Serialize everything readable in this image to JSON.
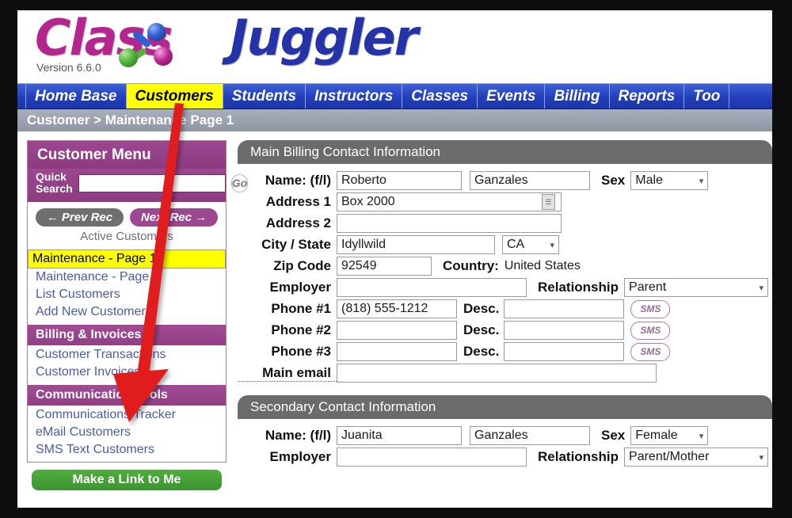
{
  "brand": {
    "name_part1": "Class",
    "name_part2": "Juggler",
    "version": "Version 6.6.0"
  },
  "nav": {
    "items": [
      {
        "label": "Home Base",
        "active": false
      },
      {
        "label": "Customers",
        "active": true
      },
      {
        "label": "Students",
        "active": false
      },
      {
        "label": "Instructors",
        "active": false
      },
      {
        "label": "Classes",
        "active": false
      },
      {
        "label": "Events",
        "active": false
      },
      {
        "label": "Billing",
        "active": false
      },
      {
        "label": "Reports",
        "active": false
      },
      {
        "label": "Too",
        "active": false
      }
    ]
  },
  "breadcrumb": "Customer > Maintenance Page 1",
  "sidebar": {
    "title": "Customer Menu",
    "quick_search": {
      "label_line1": "Quick",
      "label_line2": "Search",
      "value": "",
      "placeholder": "",
      "go_label": "Go"
    },
    "prev_label": "Prev Rec",
    "next_label": "Next Rec",
    "record_scope": "Active Customers",
    "main_links": [
      {
        "label": "Maintenance - Page 1",
        "selected": true
      },
      {
        "label": "Maintenance - Page 2",
        "selected": false
      },
      {
        "label": "List Customers",
        "selected": false
      },
      {
        "label": "Add New Customer",
        "selected": false
      }
    ],
    "groups": [
      {
        "title": "Billing & Invoices",
        "links": [
          "Customer Transactions",
          "Customer Invoices"
        ]
      },
      {
        "title": "Communication Tools",
        "links": [
          "Communications Tracker",
          "eMail Customers",
          "SMS Text Customers"
        ]
      }
    ],
    "green_button": "Make a Link to Me"
  },
  "main": {
    "section1_title": "Main Billing Contact Information",
    "section2_title": "Secondary Contact Information",
    "labels": {
      "name": "Name: (f/l)",
      "address1": "Address 1",
      "address2": "Address 2",
      "city_state": "City / State",
      "zip": "Zip Code",
      "country": "Country:",
      "employer": "Employer",
      "relationship": "Relationship",
      "sex": "Sex",
      "phone1": "Phone #1",
      "phone2": "Phone #2",
      "phone3": "Phone #3",
      "desc": "Desc.",
      "main_email": "Main email",
      "sms": "SMS"
    },
    "billing": {
      "first_name": "Roberto",
      "last_name": "Ganzales",
      "sex": "Male",
      "address1": "Box 2000",
      "address2": "",
      "city": "Idyllwild",
      "state": "CA",
      "zip": "92549",
      "country": "United States",
      "employer": "",
      "relationship": "Parent",
      "phone1": "(818) 555-1212",
      "phone1_desc": "",
      "phone2": "",
      "phone2_desc": "",
      "phone3": "",
      "phone3_desc": "",
      "main_email": ""
    },
    "secondary": {
      "first_name": "Juanita",
      "last_name": "Ganzales",
      "sex": "Female",
      "employer": "",
      "relationship": "Parent/Mother"
    }
  },
  "annotation": {
    "type": "red-arrow",
    "points_to": "Communication Tools",
    "color": "#e01b1b"
  }
}
